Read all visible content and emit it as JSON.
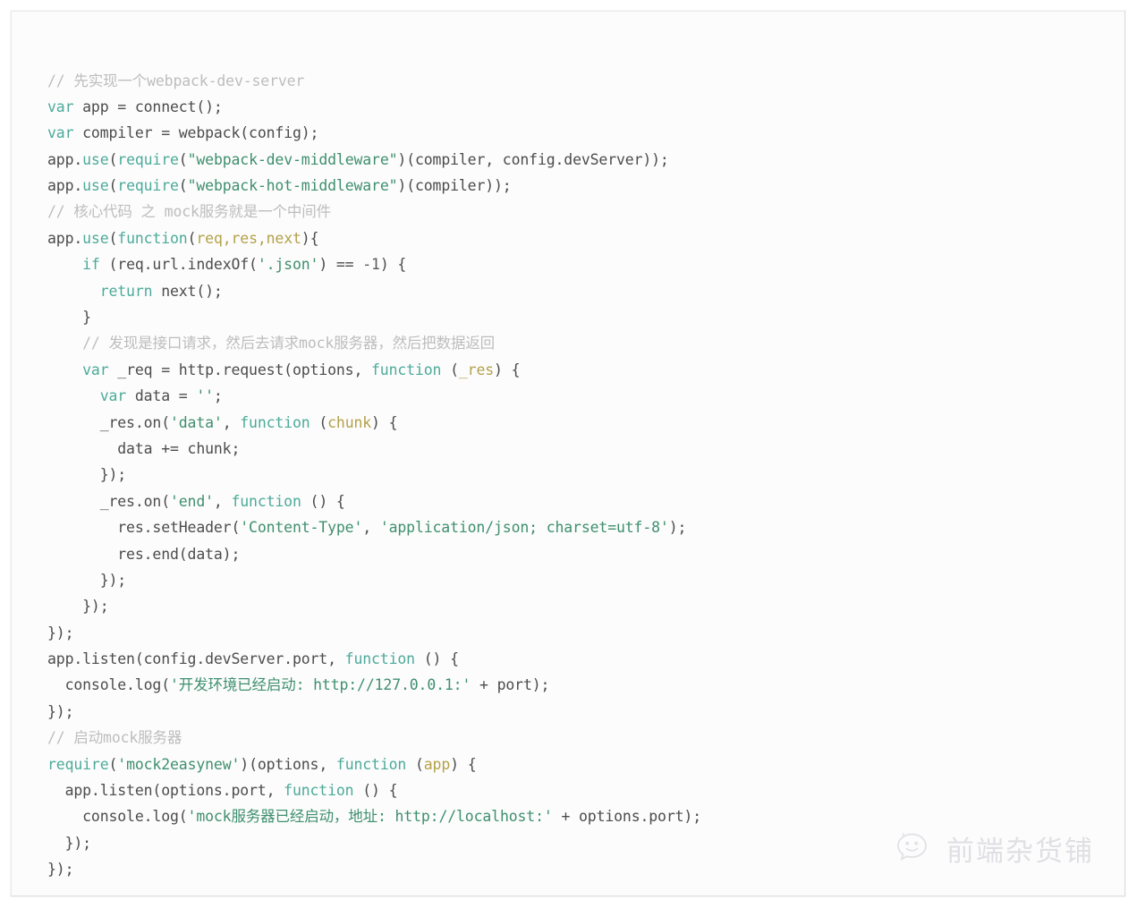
{
  "code": {
    "language": "javascript",
    "colors": {
      "background": "#fcfcfc",
      "text": "#4c4c4c",
      "keyword": "#4caa9a",
      "string": "#3f8f6f",
      "parameter": "#b4a14a",
      "comment": "#bdbdbd",
      "border": "#e8e8e8"
    },
    "lines": [
      "// 先实现一个webpack-dev-server",
      "var app = connect();",
      "var compiler = webpack(config);",
      "app.use(require(\"webpack-dev-middleware\")(compiler, config.devServer));",
      "app.use(require(\"webpack-hot-middleware\")(compiler));",
      "// 核心代码 之 mock服务就是一个中间件",
      "app.use(function(req,res,next){",
      "    if (req.url.indexOf('.json') == -1) {",
      "      return next();",
      "    }",
      "    // 发现是接口请求，然后去请求mock服务器，然后把数据返回",
      "    var _req = http.request(options, function (_res) {",
      "      var data = '';",
      "      _res.on('data', function (chunk) {",
      "        data += chunk;",
      "      });",
      "      _res.on('end', function () {",
      "        res.setHeader('Content-Type', 'application/json; charset=utf-8');",
      "        res.end(data);",
      "      });",
      "    });",
      "});",
      "app.listen(config.devServer.port, function () {",
      "  console.log('开发环境已经启动: http://127.0.0.1:' + port);",
      "});",
      "// 启动mock服务器",
      "require('mock2easynew')(options, function (app) {",
      "  app.listen(options.port, function () {",
      "    console.log('mock服务器已经启动，地址: http://localhost:' + options.port);",
      "  });",
      "});"
    ],
    "tokens": [
      [
        [
          "// 先实现一个webpack-dev-server",
          "comment"
        ]
      ],
      [
        [
          "var",
          "kw"
        ],
        [
          " app = connect();",
          "plain"
        ]
      ],
      [
        [
          "var",
          "kw"
        ],
        [
          " compiler = webpack(config);",
          "plain"
        ]
      ],
      [
        [
          "app.",
          "plain"
        ],
        [
          "use",
          "fn"
        ],
        [
          "(",
          "plain"
        ],
        [
          "require",
          "fn"
        ],
        [
          "(",
          "plain"
        ],
        [
          "\"webpack-dev-middleware\"",
          "str"
        ],
        [
          ")(compiler, config.devServer));",
          "plain"
        ]
      ],
      [
        [
          "app.",
          "plain"
        ],
        [
          "use",
          "fn"
        ],
        [
          "(",
          "plain"
        ],
        [
          "require",
          "fn"
        ],
        [
          "(",
          "plain"
        ],
        [
          "\"webpack-hot-middleware\"",
          "str"
        ],
        [
          ")(compiler));",
          "plain"
        ]
      ],
      [
        [
          "// 核心代码 之 mock服务就是一个中间件",
          "comment"
        ]
      ],
      [
        [
          "app.",
          "plain"
        ],
        [
          "use",
          "fn"
        ],
        [
          "(",
          "plain"
        ],
        [
          "function",
          "kw"
        ],
        [
          "(",
          "plain"
        ],
        [
          "req,res,next",
          "param"
        ],
        [
          "){",
          "plain"
        ]
      ],
      [
        [
          "    ",
          "plain"
        ],
        [
          "if",
          "kw"
        ],
        [
          " (req.url.indexOf(",
          "plain"
        ],
        [
          "'.json'",
          "str"
        ],
        [
          ") == ",
          "plain"
        ],
        [
          "-1",
          "num"
        ],
        [
          ") {",
          "plain"
        ]
      ],
      [
        [
          "      ",
          "plain"
        ],
        [
          "return",
          "kw"
        ],
        [
          " next();",
          "plain"
        ]
      ],
      [
        [
          "    }",
          "plain"
        ]
      ],
      [
        [
          "    // 发现是接口请求，然后去请求mock服务器，然后把数据返回",
          "comment"
        ]
      ],
      [
        [
          "    ",
          "plain"
        ],
        [
          "var",
          "kw"
        ],
        [
          " _req = http.request(options, ",
          "plain"
        ],
        [
          "function",
          "kw"
        ],
        [
          " (",
          "plain"
        ],
        [
          "_res",
          "param"
        ],
        [
          ") {",
          "plain"
        ]
      ],
      [
        [
          "      ",
          "plain"
        ],
        [
          "var",
          "kw"
        ],
        [
          " data = ",
          "plain"
        ],
        [
          "''",
          "str"
        ],
        [
          ";",
          "plain"
        ]
      ],
      [
        [
          "      _res.on(",
          "plain"
        ],
        [
          "'data'",
          "str"
        ],
        [
          ", ",
          "plain"
        ],
        [
          "function",
          "kw"
        ],
        [
          " (",
          "plain"
        ],
        [
          "chunk",
          "param"
        ],
        [
          ") {",
          "plain"
        ]
      ],
      [
        [
          "        data += chunk;",
          "plain"
        ]
      ],
      [
        [
          "      });",
          "plain"
        ]
      ],
      [
        [
          "      _res.on(",
          "plain"
        ],
        [
          "'end'",
          "str"
        ],
        [
          ", ",
          "plain"
        ],
        [
          "function",
          "kw"
        ],
        [
          " (",
          "plain"
        ],
        [
          "",
          "param"
        ],
        [
          ") {",
          "plain"
        ]
      ],
      [
        [
          "        res.setHeader(",
          "plain"
        ],
        [
          "'Content-Type'",
          "str"
        ],
        [
          ", ",
          "plain"
        ],
        [
          "'application/json; charset=utf-8'",
          "str"
        ],
        [
          ");",
          "plain"
        ]
      ],
      [
        [
          "        res.end(data);",
          "plain"
        ]
      ],
      [
        [
          "      });",
          "plain"
        ]
      ],
      [
        [
          "    });",
          "plain"
        ]
      ],
      [
        [
          "});",
          "plain"
        ]
      ],
      [
        [
          "app.listen(config.devServer.port, ",
          "plain"
        ],
        [
          "function",
          "kw"
        ],
        [
          " (",
          "plain"
        ],
        [
          "",
          "param"
        ],
        [
          ") {",
          "plain"
        ]
      ],
      [
        [
          "  console.log(",
          "plain"
        ],
        [
          "'开发环境已经启动: http://127.0.0.1:'",
          "str"
        ],
        [
          " + port);",
          "plain"
        ]
      ],
      [
        [
          "});",
          "plain"
        ]
      ],
      [
        [
          "// 启动mock服务器",
          "comment"
        ]
      ],
      [
        [
          "require",
          "fn"
        ],
        [
          "(",
          "plain"
        ],
        [
          "'mock2easynew'",
          "str"
        ],
        [
          ")(options, ",
          "plain"
        ],
        [
          "function",
          "kw"
        ],
        [
          " (",
          "plain"
        ],
        [
          "app",
          "param"
        ],
        [
          ") {",
          "plain"
        ]
      ],
      [
        [
          "  app.listen(options.port, ",
          "plain"
        ],
        [
          "function",
          "kw"
        ],
        [
          " (",
          "plain"
        ],
        [
          "",
          "param"
        ],
        [
          ") {",
          "plain"
        ]
      ],
      [
        [
          "    console.log(",
          "plain"
        ],
        [
          "'mock服务器已经启动，地址: http://localhost:'",
          "str"
        ],
        [
          " + options.port);",
          "plain"
        ]
      ],
      [
        [
          "  });",
          "plain"
        ]
      ],
      [
        [
          "});",
          "plain"
        ]
      ]
    ]
  },
  "watermark": {
    "icon": "wechat-bubble-icon",
    "text": "前端杂货铺",
    "color": "#c9c9d2"
  }
}
